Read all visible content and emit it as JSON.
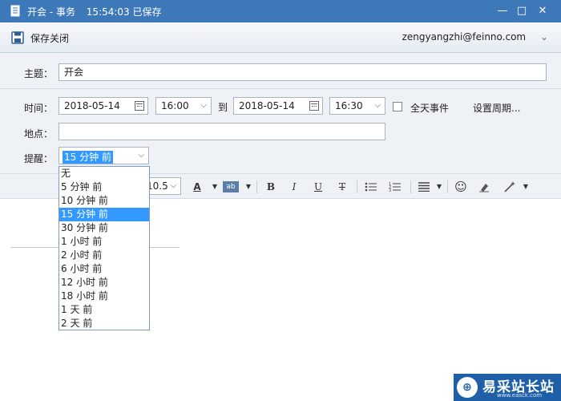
{
  "window": {
    "title": "开会 - 事务",
    "saved_status": "15:54:03 已保存",
    "controls": {
      "minimize": "—",
      "maximize": "□",
      "close": "✕"
    }
  },
  "toolbar": {
    "save_close_label": "保存关闭",
    "account": "zengyangzhi@feinno.com",
    "account_chevron": "⌄"
  },
  "form": {
    "subject_label": "主题：",
    "subject_value": "开会",
    "time_label": "时间：",
    "start_date": "2018-05-14",
    "start_time": "16:00",
    "to_label": "到",
    "end_date": "2018-05-14",
    "end_time": "16:30",
    "allday_label": "全天事件",
    "allday_checked": false,
    "recurrence_label": "设置周期...",
    "location_label": "地点：",
    "location_value": "",
    "reminder_label": "提醒：",
    "reminder_value": "15 分钟 前"
  },
  "reminder_options": [
    "无",
    "5 分钟 前",
    "10 分钟 前",
    "15 分钟 前",
    "30 分钟 前",
    "1 小时 前",
    "2 小时 前",
    "6 小时 前",
    "12 小时 前",
    "18 小时 前",
    "1 天 前",
    "2 天 前"
  ],
  "reminder_selected_index": 3,
  "format_toolbar": {
    "font_size": "10.5",
    "bold": "B",
    "italic": "I",
    "underline": "U",
    "strike": "T",
    "font_color_glyph": "A",
    "highlight_glyph": "ab",
    "emoji_glyph": "☺"
  },
  "watermark": {
    "name": "易采站长站",
    "url": "www.easck.com"
  },
  "colors": {
    "titlebar": "#3d78b8",
    "selection": "#3399ff",
    "form_bg": "#eef2f6"
  }
}
